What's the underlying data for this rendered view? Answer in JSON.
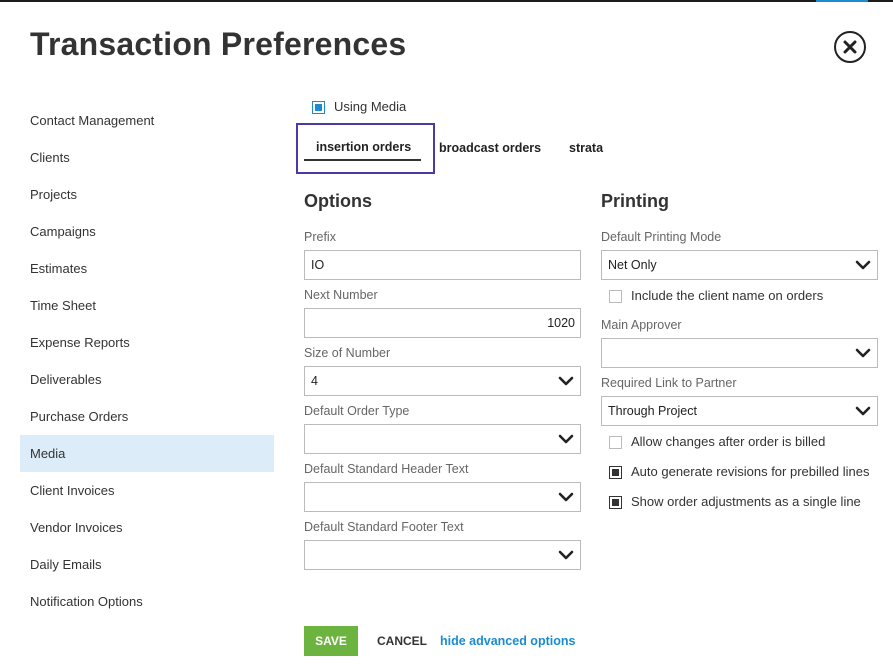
{
  "header": {
    "title": "Transaction Preferences"
  },
  "sidebar": {
    "items": [
      {
        "label": "Contact Management"
      },
      {
        "label": "Clients"
      },
      {
        "label": "Projects"
      },
      {
        "label": "Campaigns"
      },
      {
        "label": "Estimates"
      },
      {
        "label": "Time Sheet"
      },
      {
        "label": "Expense Reports"
      },
      {
        "label": "Deliverables"
      },
      {
        "label": "Purchase Orders"
      },
      {
        "label": "Media"
      },
      {
        "label": "Client Invoices"
      },
      {
        "label": "Vendor Invoices"
      },
      {
        "label": "Daily Emails"
      },
      {
        "label": "Notification Options"
      }
    ],
    "active": "Media"
  },
  "using_media": {
    "label": "Using Media",
    "checked": true
  },
  "tabs": [
    {
      "label": "insertion orders",
      "active": true
    },
    {
      "label": "broadcast orders"
    },
    {
      "label": "strata"
    }
  ],
  "options": {
    "title": "Options",
    "prefix": {
      "label": "Prefix",
      "value": "IO"
    },
    "next_number": {
      "label": "Next Number",
      "value": "1020"
    },
    "size_of_number": {
      "label": "Size of Number",
      "value": "4"
    },
    "default_order_type": {
      "label": "Default Order Type",
      "value": ""
    },
    "header_text": {
      "label": "Default Standard Header Text",
      "value": ""
    },
    "footer_text": {
      "label": "Default Standard Footer Text",
      "value": ""
    }
  },
  "printing": {
    "title": "Printing",
    "mode": {
      "label": "Default Printing Mode",
      "value": "Net Only"
    },
    "include_client": {
      "label": "Include the client name on orders",
      "checked": false
    },
    "approver": {
      "label": "Main Approver",
      "value": ""
    },
    "link_partner": {
      "label": "Required Link to Partner",
      "value": "Through Project"
    },
    "allow_changes": {
      "label": "Allow changes after order is billed",
      "checked": false
    },
    "auto_generate": {
      "label": "Auto generate revisions for prebilled lines",
      "checked": true
    },
    "show_adjustments": {
      "label": "Show order adjustments as a single line",
      "checked": true
    }
  },
  "footer": {
    "save_label": "SAVE",
    "cancel_label": "CANCEL",
    "advanced_label": "hide advanced options"
  },
  "colors": {
    "accent": "#1a8ccf",
    "save": "#6db33f",
    "active_bg": "#dcedf9",
    "focus": "#4a3aa8"
  },
  "icons": {
    "close": "close-circle-icon",
    "dropdown": "chevron-down-icon"
  }
}
